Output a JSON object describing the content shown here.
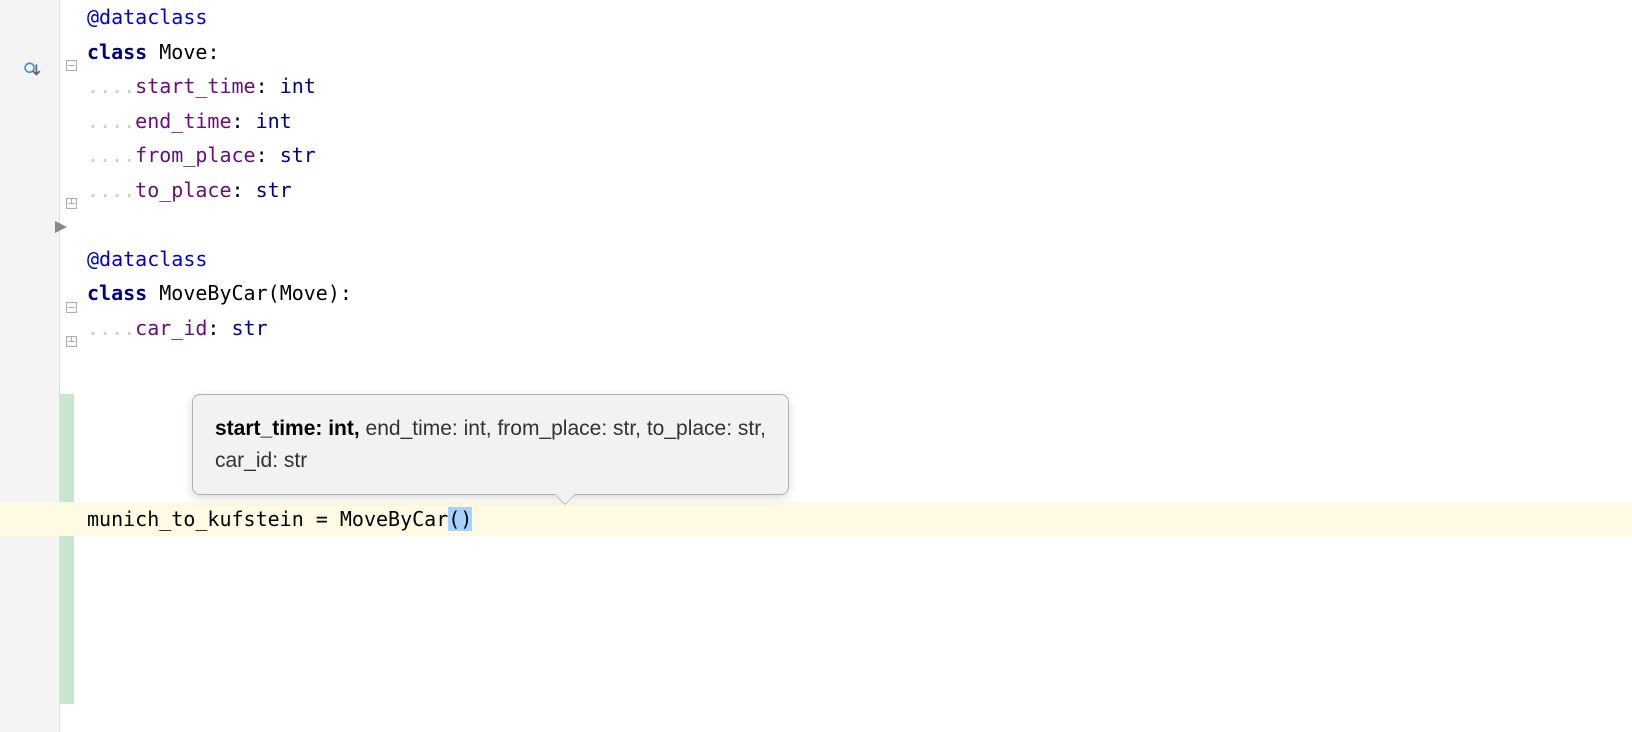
{
  "code": {
    "line1": {
      "decorator": "@dataclass"
    },
    "line2": {
      "keyword": "class",
      "name": "Move",
      "suffix": ":"
    },
    "line3": {
      "indent": "    ",
      "field": "start_time",
      "type": "int"
    },
    "line4": {
      "indent": "    ",
      "field": "end_time",
      "type": "int"
    },
    "line5": {
      "indent": "    ",
      "field": "from_place",
      "type": "str"
    },
    "line6": {
      "indent": "    ",
      "field": "to_place",
      "type": "str"
    },
    "line8": {
      "decorator": "@dataclass"
    },
    "line9": {
      "keyword": "class",
      "name": "MoveByCar",
      "parent": "Move",
      "suffix": ":"
    },
    "line10": {
      "indent": "    ",
      "field": "car_id",
      "type": "str"
    },
    "line15": {
      "var": "munich_to_kufstein",
      "equals": " = ",
      "call": "MoveByCar",
      "open": "(",
      "close": ")"
    }
  },
  "tooltip": {
    "bold": "start_time: int,",
    "rest1": " end_time: int, from_place: str, to_place: str,",
    "rest2": "car_id: str"
  }
}
